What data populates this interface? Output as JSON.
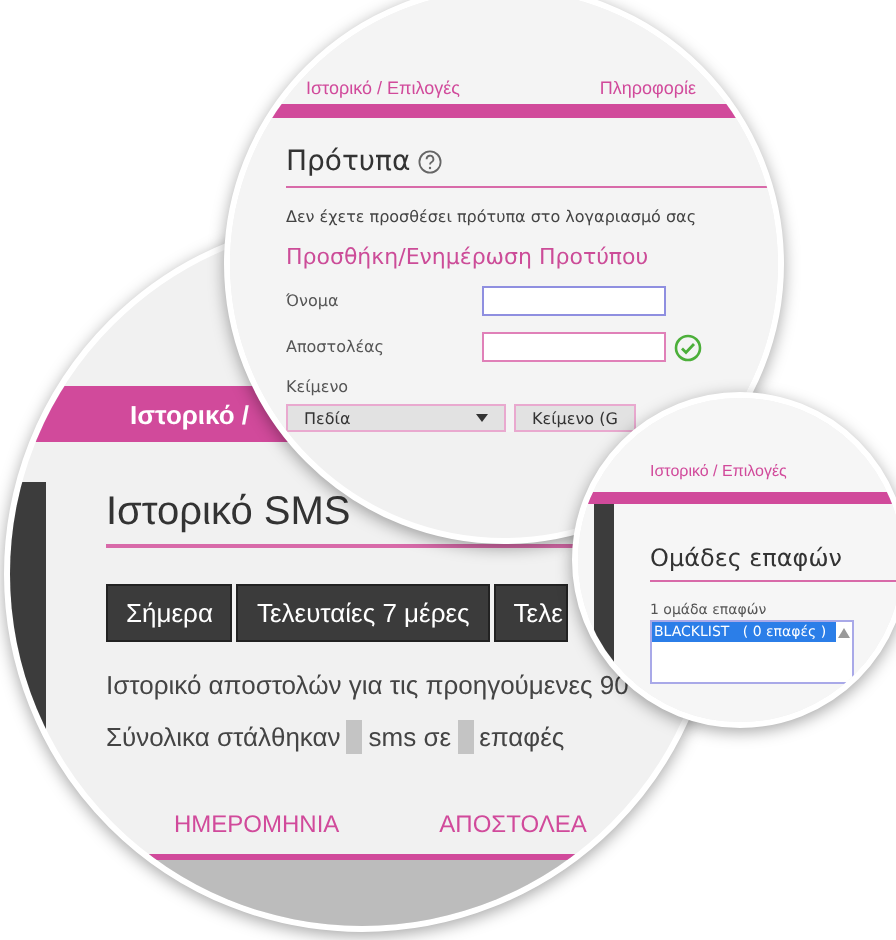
{
  "history_panel": {
    "tab": "Ιστορικό /",
    "title": "Ιστορικό SMS",
    "period_buttons": [
      {
        "label": "Σήμερα"
      },
      {
        "label": "Τελευταίες 7 μέρες"
      },
      {
        "label": "Τελε"
      }
    ],
    "description": "Ιστορικό αποστολών για τις προηγούμενες 90",
    "summary": [
      "Σύνολικα στάλθηκαν",
      "sms σε",
      "επαφές"
    ],
    "columns": [
      "ΗΜΕΡΟΜΗΝΙΑ",
      "ΑΠΟΣΤΟΛΕΑ"
    ]
  },
  "templates_panel": {
    "nav": [
      "Ιστορικό / Επιλογές",
      "Πληροφορίε"
    ],
    "title": "Πρότυπα",
    "empty_message": "Δεν έχετε προσθέσει πρότυπα στο λογαριασμό σας",
    "form_title": "Προσθήκη/Ενημέρωση Προτύπου",
    "fields": [
      {
        "label": "Όνομα",
        "focused": true,
        "valid": false
      },
      {
        "label": "Αποστολέας",
        "focused": false,
        "valid": true
      }
    ],
    "text_label": "Κείμενο",
    "selects": [
      "Πεδία",
      "Κείμενο (G"
    ]
  },
  "groups_panel": {
    "nav": "Ιστορικό / Επιλογές",
    "title": "Ομάδες επαφών",
    "count": "1 ομάδα επαφών",
    "groups": [
      {
        "label": "BLACKLIST   ( 0 επαφές )",
        "selected": true
      }
    ]
  }
}
